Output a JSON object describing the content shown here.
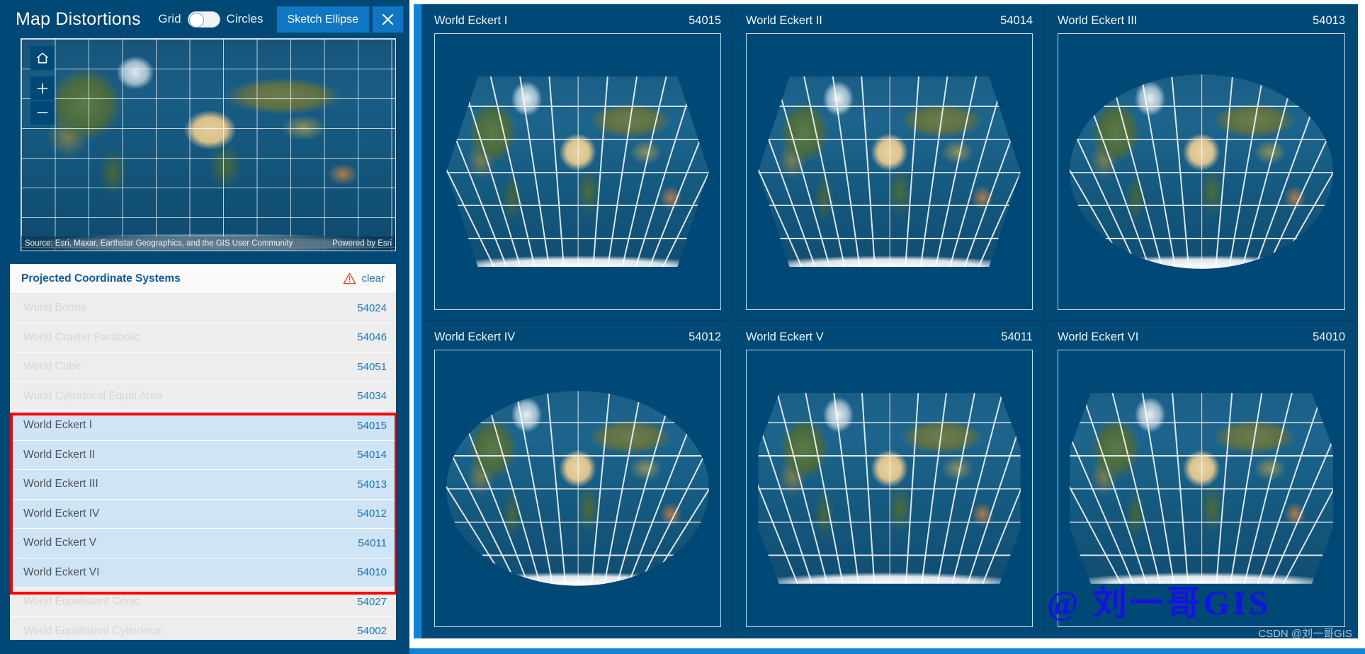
{
  "app": {
    "title": "Map Distortions",
    "accent_blue": "#0f76c3",
    "panel_blue": "#004876",
    "selection_highlight": "#ff0000"
  },
  "header": {
    "title": "Map Distortions",
    "toggle_left_label": "Grid",
    "toggle_right_label": "Circles",
    "toggle_state": "Grid",
    "sketch_button_label": "Sketch Ellipse",
    "close_icon": "close-icon"
  },
  "mini_map": {
    "home_icon": "home-icon",
    "zoom_in_icon": "plus-icon",
    "zoom_out_icon": "minus-icon",
    "attribution_source": "Source: Esri, Maxar, Earthstar Geographics, and the GIS User Community",
    "attribution_powered": "Powered by Esri"
  },
  "pcs_panel": {
    "title": "Projected Coordinate Systems",
    "warning_icon": "warning-triangle-icon",
    "clear_label": "clear",
    "rows": [
      {
        "name": "World Bonne",
        "code": "54024",
        "state": "dim"
      },
      {
        "name": "World Craster Parabolic",
        "code": "54046",
        "state": "dim"
      },
      {
        "name": "World Cube",
        "code": "54051",
        "state": "dim"
      },
      {
        "name": "World Cylindrical Equal Area",
        "code": "54034",
        "state": "dim"
      },
      {
        "name": "World Eckert I",
        "code": "54015",
        "state": "selected"
      },
      {
        "name": "World Eckert II",
        "code": "54014",
        "state": "selected"
      },
      {
        "name": "World Eckert III",
        "code": "54013",
        "state": "selected"
      },
      {
        "name": "World Eckert IV",
        "code": "54012",
        "state": "selected"
      },
      {
        "name": "World Eckert V",
        "code": "54011",
        "state": "selected"
      },
      {
        "name": "World Eckert VI",
        "code": "54010",
        "state": "selected"
      },
      {
        "name": "World Equidistant Conic",
        "code": "54027",
        "state": "dim"
      },
      {
        "name": "World Equidistant Cylindrical",
        "code": "54002",
        "state": "dim"
      }
    ]
  },
  "projection_grid": {
    "cards": [
      {
        "title": "World Eckert I",
        "code": "54015",
        "shape": "shape-eckert1"
      },
      {
        "title": "World Eckert II",
        "code": "54014",
        "shape": "shape-eckert2"
      },
      {
        "title": "World Eckert III",
        "code": "54013",
        "shape": "shape-eckert3"
      },
      {
        "title": "World Eckert IV",
        "code": "54012",
        "shape": "shape-eckert4"
      },
      {
        "title": "World Eckert V",
        "code": "54011",
        "shape": "shape-eckert5"
      },
      {
        "title": "World Eckert VI",
        "code": "54010",
        "shape": "shape-eckert6"
      }
    ]
  },
  "watermarks": {
    "main": "@ 刘一哥GIS",
    "csdn": "CSDN @刘一哥GIS"
  }
}
